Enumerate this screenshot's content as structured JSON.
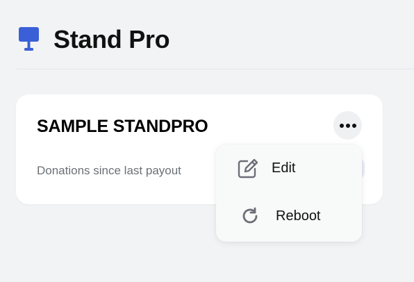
{
  "app": {
    "title": "Stand Pro",
    "icon": "stand-icon",
    "accent_color": "#3b5fd6"
  },
  "card": {
    "title": "SAMPLE STANDPRO",
    "subtitle": "Donations since last payout",
    "more_icon": "more-horizontal-icon"
  },
  "menu": {
    "items": [
      {
        "label": "Edit",
        "icon": "edit-icon"
      },
      {
        "label": "Reboot",
        "icon": "refresh-icon"
      }
    ]
  }
}
